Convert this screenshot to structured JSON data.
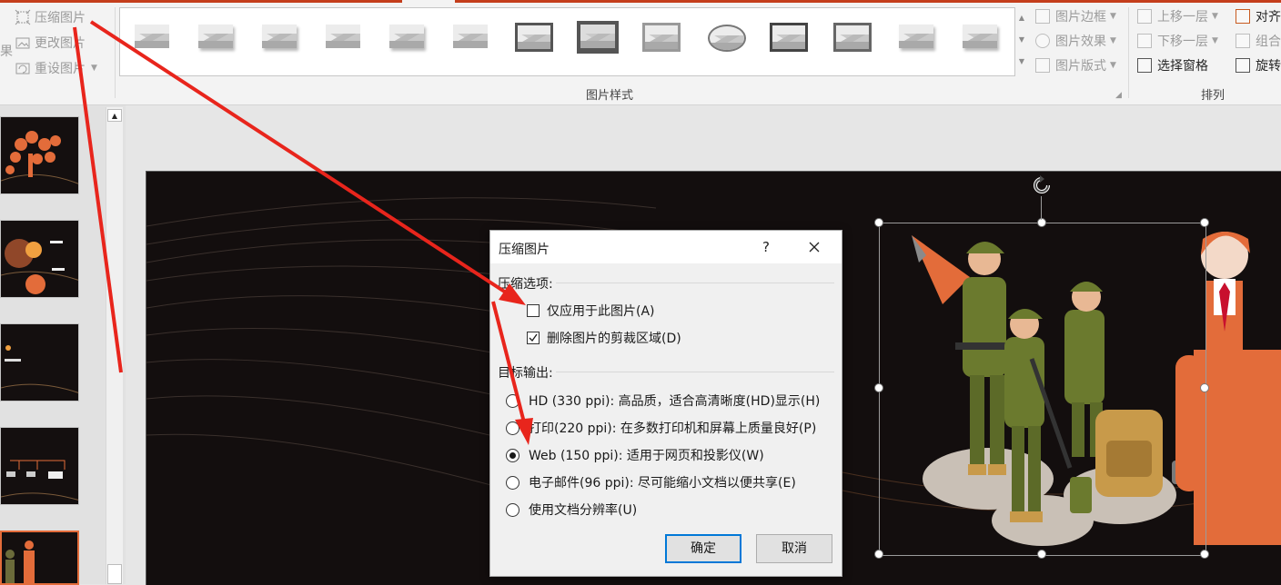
{
  "ribbon": {
    "adjust": {
      "compress": "压缩图片",
      "change": "更改图片",
      "reset": "重设图片",
      "cut_label": "果"
    },
    "styles_group_label": "图片样式",
    "picture_menu": {
      "border": "图片边框",
      "effects": "图片效果",
      "layout": "图片版式"
    },
    "arrange": {
      "bring_forward": "上移一层",
      "send_backward": "下移一层",
      "selection_pane": "选择窗格",
      "align": "对齐",
      "group": "组合",
      "rotate": "旋转",
      "label": "排列"
    }
  },
  "dialog": {
    "title": "压缩图片",
    "help": "?",
    "compress_section": "压缩选项:",
    "apply_only": "仅应用于此图片(A)",
    "apply_only_checked": false,
    "delete_crop": "删除图片的剪裁区域(D)",
    "delete_crop_checked": true,
    "target_section": "目标输出:",
    "options": [
      "HD (330 ppi): 高品质，适合高清晰度(HD)显示(H)",
      "打印(220 ppi): 在多数打印机和屏幕上质量良好(P)",
      "Web (150 ppi): 适用于网页和投影仪(W)",
      "电子邮件(96 ppi): 尽可能缩小文档以便共享(E)",
      "使用文档分辨率(U)"
    ],
    "selected_option": 2,
    "ok": "确定",
    "cancel": "取消"
  },
  "colors": {
    "accent": "#c43e1c",
    "slide_bg": "#130e0e",
    "annotation_arrow": "#e8251c",
    "thumbnail_orange": "#e36c3a"
  }
}
